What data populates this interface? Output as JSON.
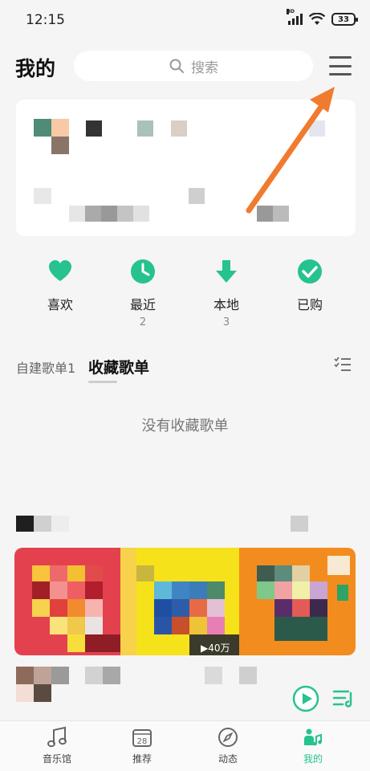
{
  "status_bar": {
    "time": "12:15",
    "signal_label": "HD",
    "battery": "33"
  },
  "header": {
    "title": "我的",
    "search_placeholder": "搜索"
  },
  "quick_actions": [
    {
      "label": "喜欢",
      "count": "",
      "icon": "heart-icon"
    },
    {
      "label": "最近",
      "count": "2",
      "icon": "clock-icon"
    },
    {
      "label": "本地",
      "count": "3",
      "icon": "download-icon"
    },
    {
      "label": "已购",
      "count": "",
      "icon": "check-icon"
    }
  ],
  "playlist_tabs": {
    "custom": "自建歌单1",
    "collected": "收藏歌单"
  },
  "empty_state": "没有收藏歌单",
  "recommend": {
    "play_count": "▶40万"
  },
  "bottom_nav": [
    {
      "label": "音乐馆",
      "icon": "music-note-icon"
    },
    {
      "label": "推荐",
      "icon": "calendar-icon",
      "badge": "28"
    },
    {
      "label": "动态",
      "icon": "compass-icon"
    },
    {
      "label": "我的",
      "icon": "profile-icon"
    }
  ],
  "colors": {
    "accent": "#26c28f",
    "arrow": "#f07b2e",
    "background": "#f5f5f5"
  }
}
